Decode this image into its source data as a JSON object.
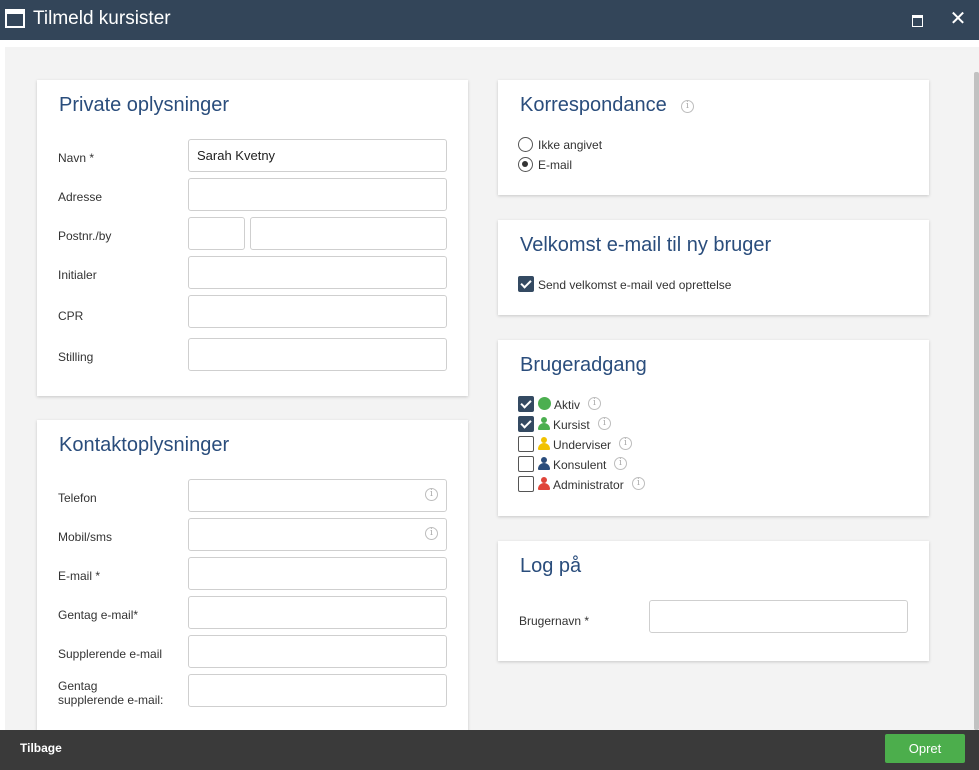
{
  "window": {
    "title": "Tilmeld kursister"
  },
  "private": {
    "title": "Private oplysninger",
    "name_label": "Navn *",
    "name_value": "Sarah Kvetny",
    "address_label": "Adresse",
    "zip_label": "Postnr./by",
    "initials_label": "Initialer",
    "cpr_label": "CPR",
    "position_label": "Stilling"
  },
  "contact": {
    "title": "Kontaktoplysninger",
    "phone_label": "Telefon",
    "mobile_label": "Mobil/sms",
    "email_label": "E-mail *",
    "repeat_email_label": "Gentag e-mail*",
    "extra_email_label": "Supplerende e-mail",
    "repeat_extra_email_label_line1": "Gentag",
    "repeat_extra_email_label_line2": "supplerende e-mail:"
  },
  "correspondence": {
    "title": "Korrespondance",
    "options": [
      "Ikke angivet",
      "E-mail"
    ],
    "selected": "E-mail"
  },
  "welcome": {
    "title": "Velkomst e-mail til ny bruger",
    "checkbox_label": "Send velkomst e-mail ved oprettelse",
    "checked": true
  },
  "access": {
    "title": "Brugeradgang",
    "items": [
      {
        "label": "Aktiv",
        "checked": true,
        "icon": "status-dot-icon",
        "color": "#4caf50"
      },
      {
        "label": "Kursist",
        "checked": true,
        "icon": "person-icon",
        "color": "#4caf50"
      },
      {
        "label": "Underviser",
        "checked": false,
        "icon": "person-icon",
        "color": "#f2c200"
      },
      {
        "label": "Konsulent",
        "checked": false,
        "icon": "person-icon",
        "color": "#2a4d7c"
      },
      {
        "label": "Administrator",
        "checked": false,
        "icon": "person-icon",
        "color": "#e0453a"
      }
    ]
  },
  "login": {
    "title": "Log på",
    "username_label": "Brugernavn *"
  },
  "footer": {
    "back_label": "Tilbage",
    "create_label": "Opret"
  },
  "colors": {
    "titlebar": "#334559",
    "heading": "#2a4d7c",
    "create_button": "#4cae4c",
    "footer": "#3a3a3a"
  }
}
